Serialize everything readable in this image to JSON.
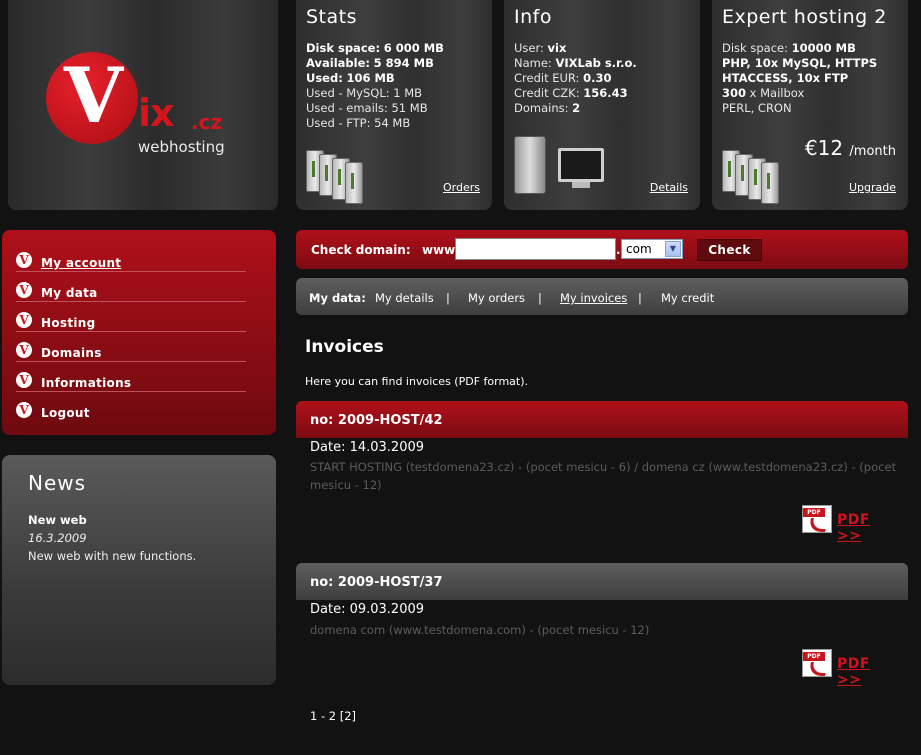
{
  "logo": {
    "letter": "V",
    "rest": "ix",
    "tld": ".cz",
    "subtitle": "webhosting"
  },
  "stats": {
    "title": "Stats",
    "disk_space_label": "Disk space:",
    "disk_space": "6 000 MB",
    "available_label": "Available:",
    "available": "5 894 MB",
    "used_label": "Used:",
    "used": "106 MB",
    "used_mysql": "Used - MySQL: 1 MB",
    "used_emails": "Used - emails: 51 MB",
    "used_ftp": "Used - FTP: 54 MB",
    "link": "Orders"
  },
  "info": {
    "title": "Info",
    "user_label": "User:",
    "user": "vix",
    "name_label": "Name:",
    "name": "VIXLab s.r.o.",
    "credit_eur_label": "Credit EUR:",
    "credit_eur": "0.30",
    "credit_czk_label": "Credit CZK:",
    "credit_czk": "156.43",
    "domains_label": "Domains:",
    "domains": "2",
    "link": "Details"
  },
  "expert": {
    "title": "Expert hosting 2",
    "disk_label": "Disk space:",
    "disk": "10000 MB",
    "line2": "PHP, 10x MySQL, HTTPS",
    "line3": "HTACCESS, 10x FTP",
    "mailbox_count": "300",
    "mailbox_label": "x Mailbox",
    "line5": "PERL, CRON",
    "price": "€12",
    "per": "/month",
    "link": "Upgrade"
  },
  "menu": {
    "bullet": "V",
    "items": [
      {
        "label": "My account"
      },
      {
        "label": "My data"
      },
      {
        "label": "Hosting"
      },
      {
        "label": "Domains"
      },
      {
        "label": "Informations"
      },
      {
        "label": "Logout"
      }
    ]
  },
  "news": {
    "title": "News",
    "headline": "New web",
    "date": "16.3.2009",
    "text": "New web with new functions."
  },
  "check": {
    "label": "Check domain:",
    "www": "www.",
    "input_value": "",
    "dot": ".",
    "tld": "com",
    "button": "Check"
  },
  "mydata": {
    "label": "My data:",
    "links": [
      "My details",
      "My orders",
      "My invoices",
      "My credit"
    ],
    "separator": "|"
  },
  "page": {
    "title": "Invoices",
    "intro": "Here you can find invoices (PDF format)."
  },
  "invoices": [
    {
      "number": "no: 2009-HOST/42",
      "date": "Date: 14.03.2009",
      "description": "START HOSTING (testdomena23.cz) - (pocet mesicu - 6) / domena cz (www.testdomena23.cz) - (pocet mesicu - 12)",
      "pdf_label": "PDF >>",
      "pdf_tag": "PDF"
    },
    {
      "number": "no: 2009-HOST/37",
      "date": "Date: 09.03.2009",
      "description": "domena com (www.testdomena.com) - (pocet mesicu - 12)",
      "pdf_label": "PDF >>",
      "pdf_tag": "PDF"
    }
  ],
  "pager": {
    "text": "1 - 2 [2]"
  }
}
